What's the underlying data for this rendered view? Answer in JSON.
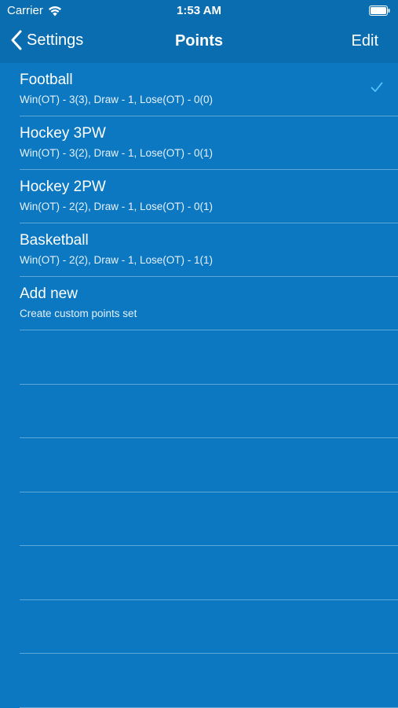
{
  "status_bar": {
    "carrier": "Carrier",
    "time": "1:53 AM"
  },
  "nav": {
    "back_label": "Settings",
    "title": "Points",
    "edit_label": "Edit"
  },
  "rows": [
    {
      "title": "Football",
      "subtitle": "Win(OT) - 3(3), Draw - 1, Lose(OT) - 0(0)",
      "selected": true
    },
    {
      "title": "Hockey 3PW",
      "subtitle": "Win(OT) - 3(2), Draw - 1, Lose(OT) - 0(1)",
      "selected": false
    },
    {
      "title": "Hockey 2PW",
      "subtitle": "Win(OT) - 2(2), Draw - 1, Lose(OT) - 0(1)",
      "selected": false
    },
    {
      "title": "Basketball",
      "subtitle": "Win(OT) - 2(2), Draw - 1, Lose(OT) - 1(1)",
      "selected": false
    },
    {
      "title": "Add new",
      "subtitle": "Create custom points set",
      "selected": false
    }
  ],
  "colors": {
    "background": "#0b78c1",
    "nav_background": "#0a6db0",
    "checkmark": "#4fc3f7"
  },
  "icons": {
    "wifi": "wifi-icon",
    "battery": "battery-icon",
    "back": "chevron-left-icon",
    "selected": "checkmark-icon"
  }
}
